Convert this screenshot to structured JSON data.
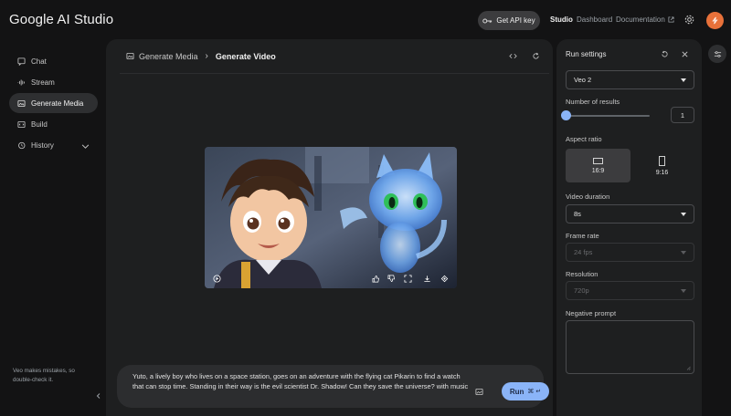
{
  "app": {
    "logo": "Google AI Studio",
    "get_api_key": "Get API key",
    "nav": {
      "studio": "Studio",
      "dashboard": "Dashboard",
      "documentation": "Documentation"
    },
    "avatar_initial": "⚡"
  },
  "sidebar": {
    "items": [
      {
        "label": "Chat",
        "icon": "chat-icon"
      },
      {
        "label": "Stream",
        "icon": "stream-icon"
      },
      {
        "label": "Generate Media",
        "icon": "media-icon"
      },
      {
        "label": "Build",
        "icon": "build-icon"
      },
      {
        "label": "History",
        "icon": "history-icon"
      }
    ],
    "disclaimer": "Veo makes mistakes, so double-check it."
  },
  "main": {
    "breadcrumb": {
      "parent": "Generate Media",
      "separator": "›",
      "current": "Generate Video"
    },
    "prompt_text": "Yuto, a lively boy who lives on a space station, goes on an adventure with the flying cat Pikarin to find a watch that can stop time. Standing in their way is the evil scientist Dr. Shadow! Can they save the universe? with music",
    "run_label": "Run",
    "run_shortcut": "⌘ ↵"
  },
  "settings": {
    "title": "Run settings",
    "model": "Veo 2",
    "number_of_results_label": "Number of results",
    "number_of_results": "1",
    "aspect_ratio_label": "Aspect ratio",
    "aspect_options": [
      "16:9",
      "9:16"
    ],
    "video_duration_label": "Video duration",
    "video_duration": "8s",
    "frame_rate_label": "Frame rate",
    "frame_rate": "24 fps",
    "resolution_label": "Resolution",
    "resolution": "720p",
    "negative_prompt_label": "Negative prompt"
  },
  "colors": {
    "accent": "#8ab4f8",
    "avatar": "#e8713a",
    "panel": "#1e1f20",
    "background": "#131314"
  }
}
